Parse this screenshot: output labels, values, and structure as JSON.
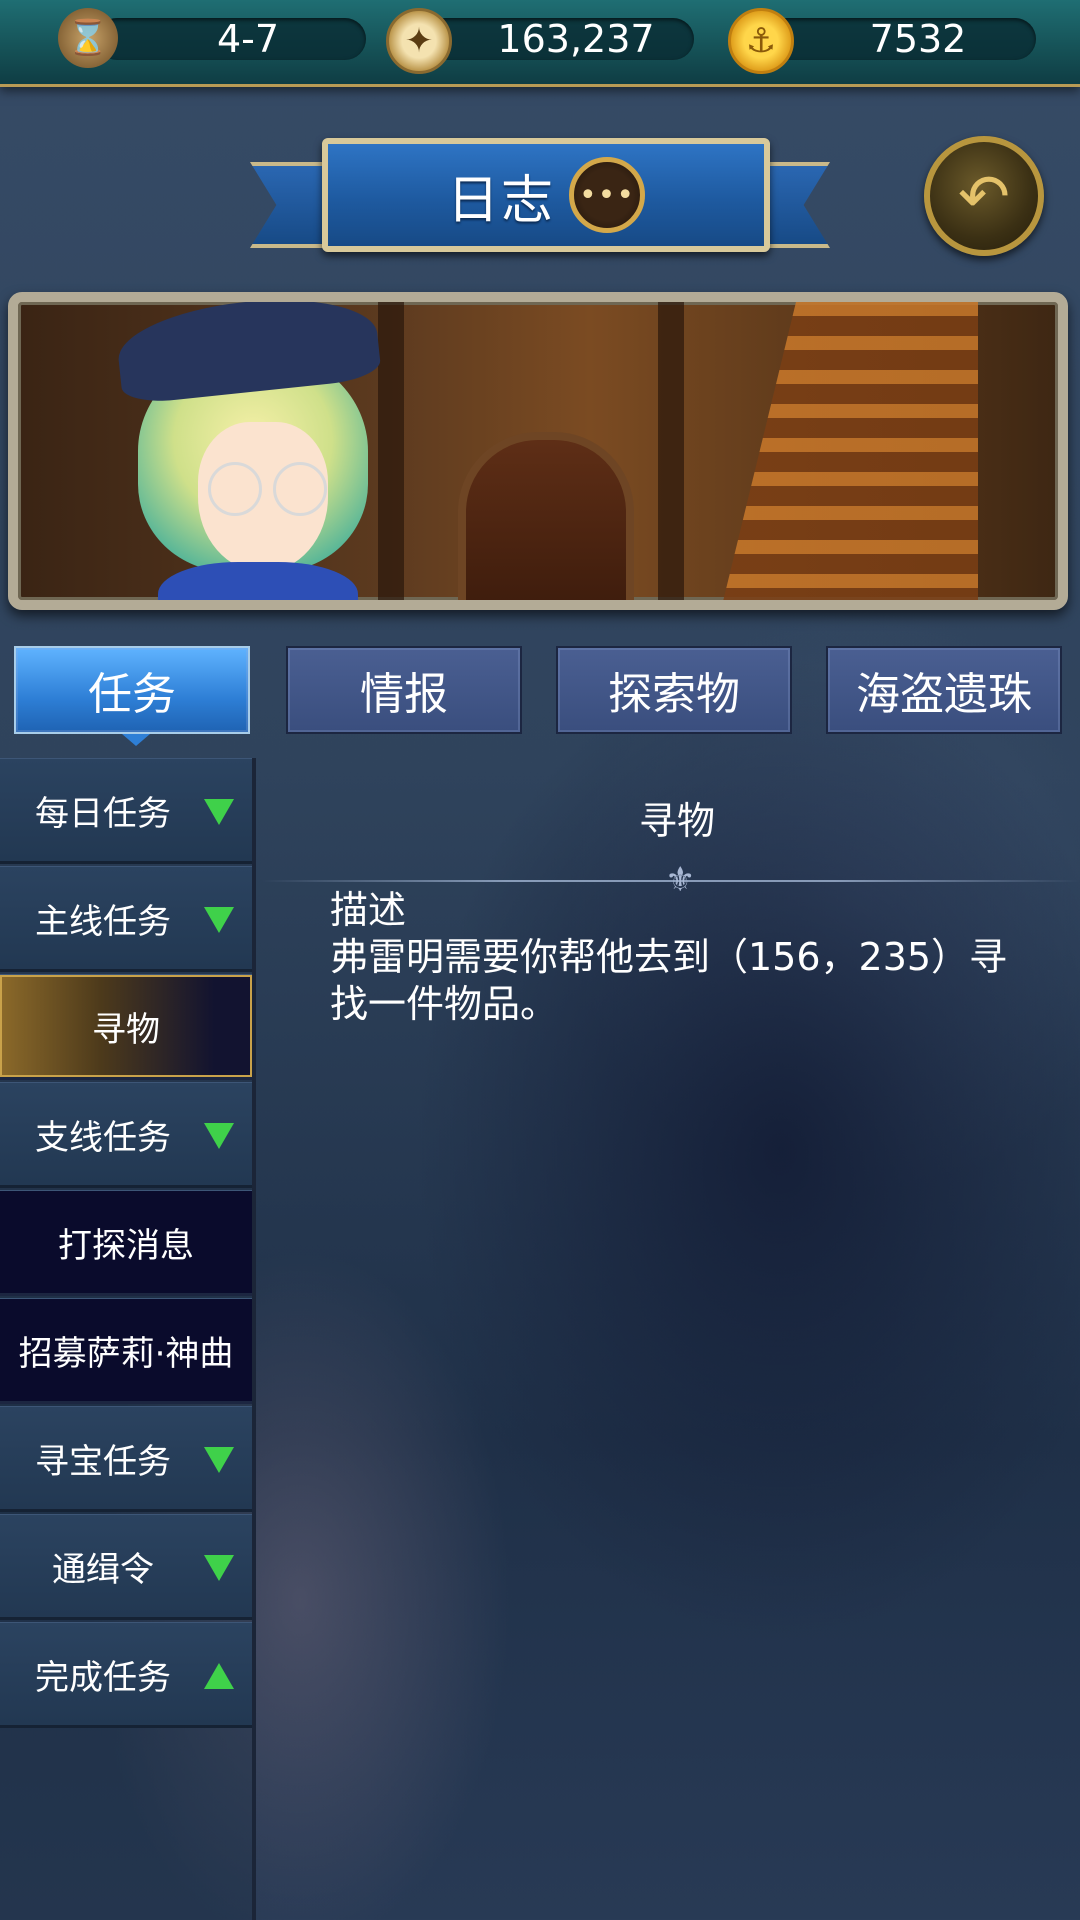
{
  "resources": {
    "level": "4-7",
    "compass_value": "163,237",
    "coin_value": "7532",
    "level_icon": "hourglass-icon",
    "compass_icon": "compass-icon",
    "coin_icon": "anchor-coin-icon"
  },
  "header": {
    "title": "日志",
    "chat_icon": "speech-bubble-icon",
    "back_icon": "back-arrow-icon"
  },
  "tabs": [
    {
      "label": "任务",
      "active": true
    },
    {
      "label": "情报",
      "active": false
    },
    {
      "label": "探索物",
      "active": false
    },
    {
      "label": "海盗遗珠",
      "active": false
    }
  ],
  "sidebar": {
    "items": [
      {
        "label": "每日任务",
        "type": "category",
        "arrow": "down"
      },
      {
        "label": "主线任务",
        "type": "category",
        "arrow": "down"
      },
      {
        "label": "寻物",
        "type": "quest",
        "selected": true
      },
      {
        "label": "支线任务",
        "type": "category",
        "arrow": "down"
      },
      {
        "label": "打探消息",
        "type": "quest"
      },
      {
        "label": "招募萨莉·神曲",
        "type": "quest"
      },
      {
        "label": "寻宝任务",
        "type": "category",
        "arrow": "down"
      },
      {
        "label": "通缉令",
        "type": "category",
        "arrow": "down"
      },
      {
        "label": "完成任务",
        "type": "category",
        "arrow": "up"
      }
    ]
  },
  "detail": {
    "title": "寻物",
    "description_heading": "描述",
    "description_text": "弗雷明需要你帮他去到（156，235）寻找一件物品。"
  },
  "colors": {
    "accent_blue": "#2e7fd6",
    "arrow_green": "#3fd14a",
    "gold": "#c9a24a"
  }
}
